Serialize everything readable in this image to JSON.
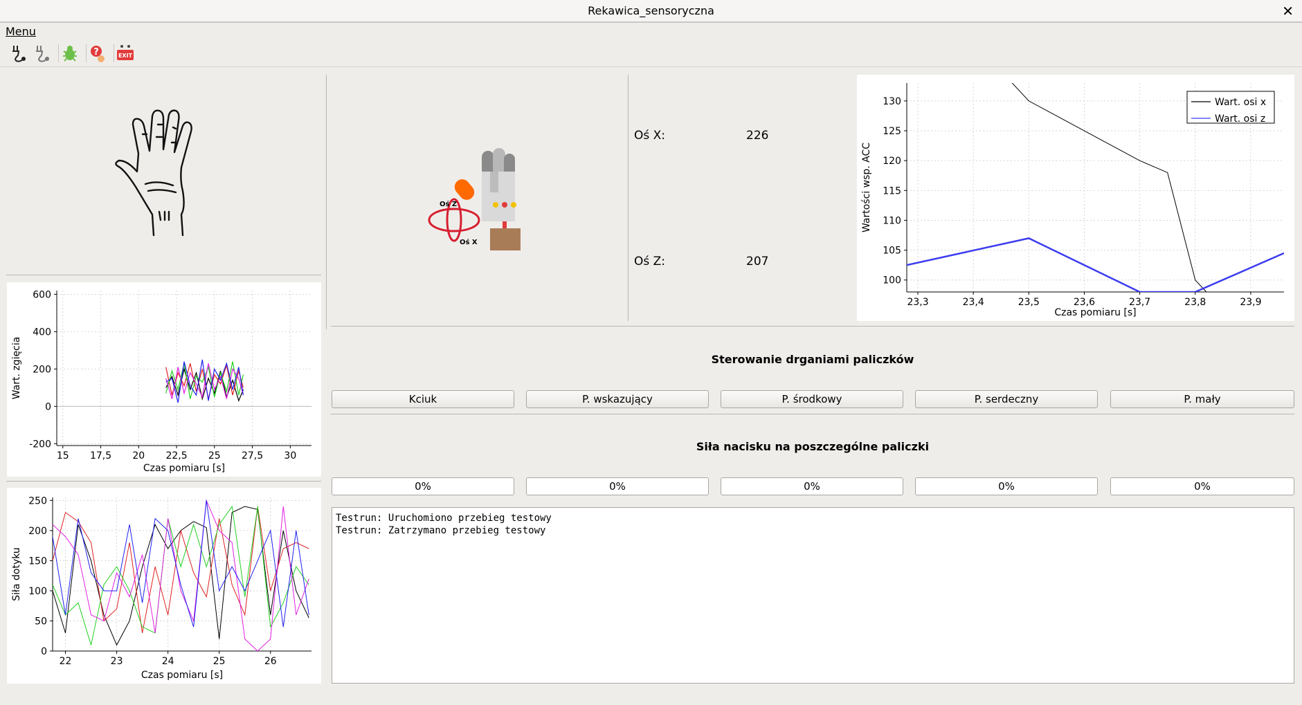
{
  "window": {
    "title": "Rekawica_sensoryczna",
    "close_symbol": "✕"
  },
  "menu": {
    "label": "Menu"
  },
  "toolbar": {
    "buttons": [
      {
        "icon": "connect-plug-icon"
      },
      {
        "icon": "disconnect-plug-icon"
      },
      {
        "icon": "bug-debug-icon"
      },
      {
        "icon": "help-icon"
      },
      {
        "icon": "exit-icon",
        "text": "EXIT"
      }
    ]
  },
  "orientation": {
    "x_label": "Oś X:",
    "x_value": "226",
    "z_label": "Oś Z:",
    "z_value": "207",
    "img_label_z": "Oś Z",
    "img_label_x": "Oś X"
  },
  "vibration": {
    "title": "Sterowanie drganiami paliczków",
    "buttons": [
      "Kciuk",
      "P. wskazujący",
      "P. środkowy",
      "P. serdeczny",
      "P. mały"
    ]
  },
  "pressure": {
    "title": "Siła nacisku na poszczególne paliczki",
    "values": [
      "0%",
      "0%",
      "0%",
      "0%",
      "0%"
    ]
  },
  "log": {
    "lines": [
      "Testrun: Uruchomiono przebieg testowy",
      "Testrun: Zatrzymano przebieg testowy"
    ]
  },
  "chart_data": [
    {
      "id": "acc",
      "type": "line",
      "xlabel": "Czas pomiaru [s]",
      "ylabel": "Wartości wsp. ACC",
      "xlim": [
        23.28,
        23.96
      ],
      "ylim": [
        98,
        133
      ],
      "xticks": [
        23.3,
        23.4,
        23.5,
        23.6,
        23.7,
        23.8,
        23.9
      ],
      "xtick_labels": [
        "23,3",
        "23,4",
        "23,5",
        "23,6",
        "23,7",
        "23,8",
        "23,9"
      ],
      "yticks": [
        100,
        105,
        110,
        115,
        120,
        125,
        130
      ],
      "grid": true,
      "legend": "top-right",
      "series": [
        {
          "name": "Wart. osi x",
          "color": "#000000",
          "x": [
            23.45,
            23.5,
            23.6,
            23.7,
            23.75,
            23.8,
            23.82
          ],
          "y": [
            135,
            130,
            125,
            120,
            118,
            100,
            98
          ]
        },
        {
          "name": "Wart. osi z",
          "color": "#3c3cf0",
          "x": [
            23.28,
            23.5,
            23.7,
            23.8,
            23.96
          ],
          "y": [
            102.5,
            107,
            98,
            98,
            104.5
          ]
        }
      ]
    },
    {
      "id": "bend",
      "type": "line",
      "xlabel": "Czas pomiaru [s]",
      "ylabel": "Wart. zgięcia",
      "xlim": [
        14.6,
        31.4
      ],
      "ylim": [
        -210,
        620
      ],
      "xticks": [
        15,
        17.5,
        20,
        22.5,
        25,
        27.5,
        30
      ],
      "xtick_labels": [
        "15",
        "17,5",
        "20",
        "22,5",
        "25",
        "27,5",
        "30"
      ],
      "yticks": [
        -200,
        0,
        200,
        400,
        600
      ],
      "grid": true,
      "series": [
        {
          "color": "#000000",
          "x": [
            21.8,
            22.2,
            22.6,
            23.0,
            23.4,
            23.8,
            24.2,
            24.6,
            25.0,
            25.4,
            25.8,
            26.2,
            26.6,
            26.9
          ],
          "y": [
            100,
            160,
            60,
            200,
            90,
            180,
            40,
            150,
            70,
            190,
            50,
            140,
            30,
            90
          ]
        },
        {
          "color": "#e02020",
          "x": [
            21.8,
            22.2,
            22.6,
            23.0,
            23.4,
            23.8,
            24.2,
            24.6,
            25.0,
            25.4,
            25.8,
            26.2,
            26.6,
            26.9
          ],
          "y": [
            210,
            60,
            180,
            110,
            230,
            80,
            200,
            40,
            170,
            120,
            220,
            60,
            190,
            100
          ]
        },
        {
          "color": "#20d020",
          "x": [
            21.8,
            22.2,
            22.6,
            23.0,
            23.4,
            23.8,
            24.2,
            24.6,
            25.0,
            25.4,
            25.8,
            26.2,
            26.6,
            26.9
          ],
          "y": [
            70,
            190,
            90,
            230,
            40,
            160,
            130,
            210,
            50,
            180,
            80,
            240,
            60,
            170
          ]
        },
        {
          "color": "#e020e0",
          "x": [
            21.8,
            22.2,
            22.6,
            23.0,
            23.4,
            23.8,
            24.2,
            24.6,
            25.0,
            25.4,
            25.8,
            26.2,
            26.6,
            26.9
          ],
          "y": [
            150,
            40,
            210,
            70,
            180,
            120,
            50,
            230,
            90,
            160,
            40,
            200,
            150,
            60
          ]
        },
        {
          "color": "#2020f0",
          "x": [
            21.8,
            22.2,
            22.6,
            23.0,
            23.4,
            23.8,
            24.2,
            24.6,
            25.0,
            25.4,
            25.8,
            26.2,
            26.6,
            26.9
          ],
          "y": [
            130,
            150,
            20,
            240,
            110,
            60,
            250,
            30,
            200,
            140,
            230,
            90,
            210,
            60
          ]
        }
      ]
    },
    {
      "id": "touch",
      "type": "line",
      "xlabel": "Czas pomiaru [s]",
      "ylabel": "Siła dotyku",
      "xlim": [
        21.75,
        26.8
      ],
      "ylim": [
        0,
        255
      ],
      "xticks": [
        22,
        23,
        24,
        25,
        26
      ],
      "xtick_labels": [
        "22",
        "23",
        "24",
        "25",
        "26"
      ],
      "yticks": [
        0,
        50,
        100,
        150,
        200,
        250
      ],
      "grid": true,
      "series": [
        {
          "color": "#000000",
          "x": [
            21.75,
            22.0,
            22.25,
            22.5,
            22.75,
            23.0,
            23.25,
            23.5,
            23.75,
            24.0,
            24.25,
            24.5,
            24.75,
            25.0,
            25.25,
            25.5,
            25.75,
            26.0,
            26.25,
            26.5,
            26.75
          ],
          "y": [
            100,
            30,
            210,
            150,
            60,
            10,
            50,
            140,
            210,
            170,
            200,
            215,
            205,
            20,
            230,
            240,
            235,
            60,
            200,
            100,
            55
          ]
        },
        {
          "color": "#e02020",
          "x": [
            21.75,
            22.0,
            22.25,
            22.5,
            22.75,
            23.0,
            23.25,
            23.5,
            23.75,
            24.0,
            24.25,
            24.5,
            24.75,
            25.0,
            25.25,
            25.5,
            25.75,
            26.0,
            26.25,
            26.5,
            26.75
          ],
          "y": [
            150,
            230,
            215,
            180,
            50,
            70,
            180,
            30,
            140,
            60,
            200,
            130,
            90,
            220,
            110,
            60,
            240,
            100,
            170,
            180,
            170
          ]
        },
        {
          "color": "#20d020",
          "x": [
            21.75,
            22.0,
            22.25,
            22.5,
            22.75,
            23.0,
            23.25,
            23.5,
            23.75,
            24.0,
            24.25,
            24.5,
            24.75,
            25.0,
            25.25,
            25.5,
            25.75,
            26.0,
            26.25,
            26.5,
            26.75
          ],
          "y": [
            110,
            60,
            80,
            10,
            110,
            140,
            100,
            40,
            30,
            220,
            140,
            210,
            140,
            210,
            240,
            90,
            240,
            40,
            80,
            140,
            110
          ]
        },
        {
          "color": "#e020e0",
          "x": [
            21.75,
            22.0,
            22.25,
            22.5,
            22.75,
            23.0,
            23.25,
            23.5,
            23.75,
            24.0,
            24.25,
            24.5,
            24.75,
            25.0,
            25.25,
            25.5,
            25.75,
            26.0,
            26.25,
            26.5,
            26.75
          ],
          "y": [
            210,
            190,
            160,
            60,
            50,
            130,
            90,
            160,
            30,
            220,
            100,
            50,
            250,
            200,
            180,
            20,
            0,
            20,
            240,
            60,
            120
          ]
        },
        {
          "color": "#2020f0",
          "x": [
            21.75,
            22.0,
            22.25,
            22.5,
            22.75,
            23.0,
            23.25,
            23.5,
            23.75,
            24.0,
            24.25,
            24.5,
            24.75,
            25.0,
            25.25,
            25.5,
            25.75,
            26.0,
            26.25,
            26.5,
            26.75
          ],
          "y": [
            190,
            60,
            220,
            130,
            100,
            100,
            210,
            80,
            220,
            200,
            110,
            40,
            250,
            100,
            140,
            100,
            150,
            200,
            40,
            200,
            60
          ]
        }
      ]
    }
  ]
}
